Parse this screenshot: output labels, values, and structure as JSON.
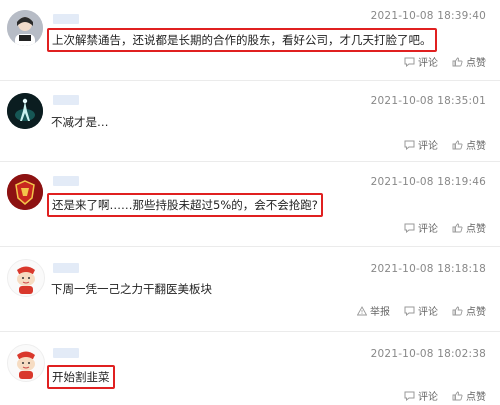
{
  "comments": [
    {
      "timestamp": "2021-10-08 18:39:40",
      "content": "上次解禁通告，还说都是长期的合作的股东，看好公司，才几天打脸了吧。",
      "actions": [
        "评论",
        "点赞"
      ]
    },
    {
      "timestamp": "2021-10-08 18:35:01",
      "content": "不减才是…",
      "actions": [
        "评论",
        "点赞"
      ]
    },
    {
      "timestamp": "2021-10-08 18:19:46",
      "content": "还是来了啊……那些持股未超过5%的，会不会抢跑?",
      "actions": [
        "评论",
        "点赞"
      ]
    },
    {
      "timestamp": "2021-10-08 18:18:18",
      "content": "下周一凭一己之力干翻医美板块",
      "actions": [
        "举报",
        "评论",
        "点赞"
      ]
    },
    {
      "timestamp": "2021-10-08 18:02:38",
      "content": "开始割韭菜",
      "actions": [
        "评论",
        "点赞"
      ]
    }
  ],
  "colors": {
    "highlight_border": "#e02020",
    "timestamp": "#888888"
  }
}
